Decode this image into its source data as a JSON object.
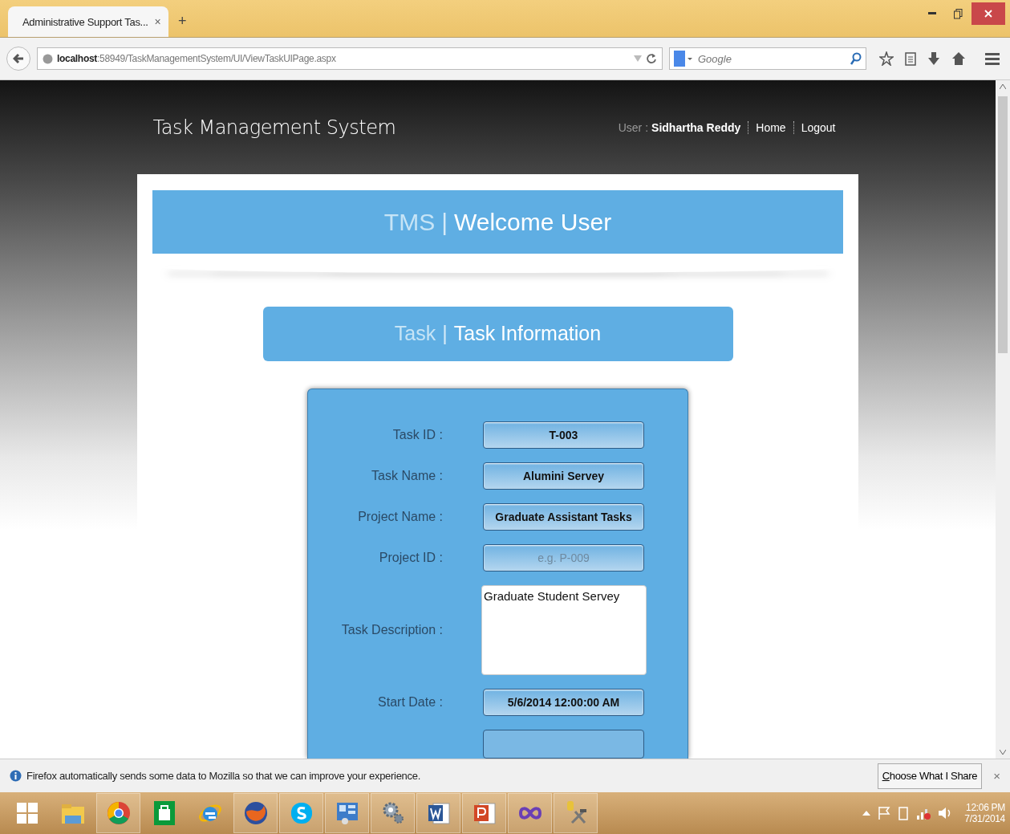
{
  "browser": {
    "tab": {
      "title": "Administrative Support Tas...",
      "close": "×",
      "new_tab": "+"
    },
    "url": "**localhost**:58949/TaskManagementSystem/UI/ViewTaskUIPage.aspx",
    "search": {
      "placeholder": "Google"
    }
  },
  "header": {
    "title": "Task Management System",
    "user_label": "User :",
    "user_name": "Sidhartha Reddy",
    "links": [
      "Home",
      "Logout"
    ]
  },
  "welcome_banner": {
    "prefix": "TMS",
    "divider": "|",
    "title": "Welcome User"
  },
  "task_banner": {
    "prefix": "Task",
    "divider": "|",
    "title": "Task Information"
  },
  "form": {
    "fields": [
      {
        "kind": "text",
        "label": "Task ID :",
        "value": "T-003"
      },
      {
        "kind": "text",
        "label": "Task Name :",
        "value": "Alumini Servey"
      },
      {
        "kind": "text",
        "label": "Project Name :",
        "value": "Graduate Assistant Tasks"
      },
      {
        "kind": "text",
        "label": "Project ID :",
        "placeholder": "e.g. P-009"
      },
      {
        "kind": "textarea",
        "label": "Task Description :",
        "value": "Graduate Student Servey"
      },
      {
        "kind": "text",
        "label": "Start Date :",
        "value": "5/6/2014 12:00:00 AM"
      }
    ]
  },
  "notification": {
    "message": "Firefox automatically sends some data to Mozilla so that we can improve your experience.",
    "button": "Choose What I Share",
    "close": "×"
  },
  "taskbar": {
    "apps": [
      {
        "kind": "folder",
        "running": false
      },
      {
        "kind": "chrome",
        "running": true
      },
      {
        "kind": "store",
        "running": false
      },
      {
        "kind": "ie",
        "running": false
      },
      {
        "kind": "firefox",
        "running": true
      },
      {
        "kind": "skype",
        "running": true
      },
      {
        "kind": "panel",
        "running": true
      },
      {
        "kind": "gears",
        "running": true
      },
      {
        "kind": "word",
        "running": true
      },
      {
        "kind": "powerpoint",
        "running": true
      },
      {
        "kind": "infinity",
        "running": true
      },
      {
        "kind": "tools",
        "running": true
      }
    ],
    "time": "12:06 PM",
    "date": "7/31/2014"
  }
}
